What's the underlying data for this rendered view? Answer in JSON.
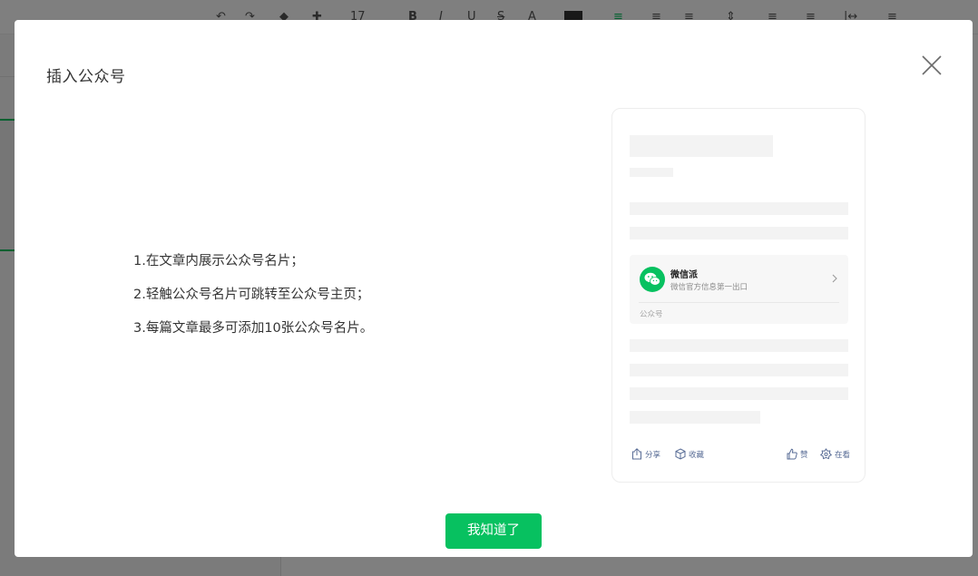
{
  "dialog": {
    "title": "插入公众号",
    "features": [
      "1.在文章内展示公众号名片；",
      "2.轻触公众号名片可跳转至公众号主页；",
      "3.每篇文章最多可添加10张公众号名片。"
    ],
    "confirm_label": "我知道了"
  },
  "preview": {
    "account_name": "微信派",
    "account_desc": "微信官方信息第一出口",
    "account_type": "公众号",
    "actions": {
      "share": "分享",
      "favorite": "收藏",
      "like": "赞",
      "watching": "在看"
    }
  },
  "toolbar": {
    "font_size": "17",
    "icons": [
      "undo-icon",
      "redo-icon",
      "format-painter-icon",
      "clear-format-icon",
      "bold-icon",
      "italic-icon",
      "underline-icon",
      "strikethrough-icon",
      "font-color-icon",
      "bg-color-icon",
      "align-icon",
      "list-icon",
      "indent-icon",
      "line-height-icon",
      "spacing-icon",
      "divider-icon"
    ]
  },
  "colors": {
    "primary": "#07c160",
    "overlay": "rgba(0,0,0,0.5)",
    "link": "#576b95"
  }
}
